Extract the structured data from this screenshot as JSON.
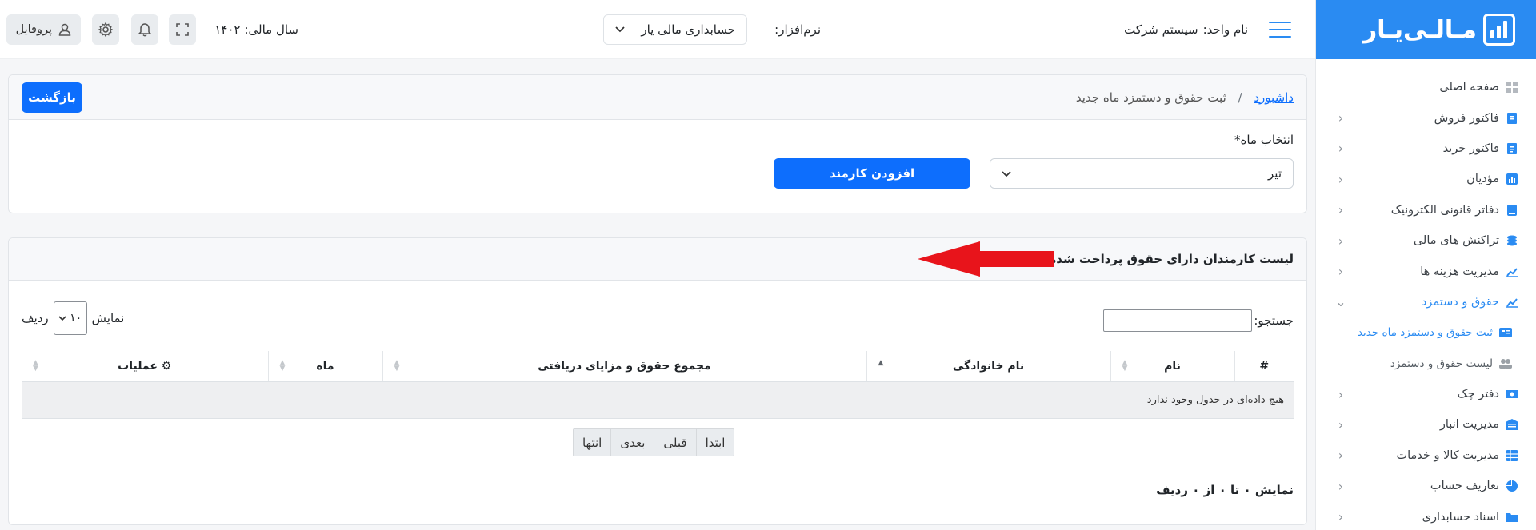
{
  "brand": {
    "logo_text": "مـالـی‌یـار"
  },
  "topbar": {
    "unit_label": "نام واحد:",
    "unit_value": "سیستم شرکت",
    "software_label": "نرم‌افزار:",
    "software_value": "حسابداری مالی یار",
    "fiscal_year_label": "سال مالی:",
    "fiscal_year_value": "۱۴۰۲",
    "profile_label": "پروفایل"
  },
  "sidebar": {
    "items": [
      {
        "label": "صفحه اصلی",
        "icon": "dashboard-icon"
      },
      {
        "label": "فاکتور فروش",
        "icon": "invoice-icon"
      },
      {
        "label": "فاکتور خرید",
        "icon": "purchase-invoice-icon"
      },
      {
        "label": "مؤدیان",
        "icon": "chart-icon"
      },
      {
        "label": "دفاتر قانونی الکترونیک",
        "icon": "book-icon"
      },
      {
        "label": "تراکنش های مالی",
        "icon": "coins-icon"
      },
      {
        "label": "مدیریت هزینه ها",
        "icon": "line-chart-icon"
      },
      {
        "label": "حقوق و دستمزد",
        "icon": "salary-icon"
      },
      {
        "label": "ثبت حقوق و دستمزد ماه جدید",
        "icon": "id-card-icon"
      },
      {
        "label": "لیست حقوق و دستمزد",
        "icon": "users-icon"
      },
      {
        "label": "دفتر چک",
        "icon": "money-icon"
      },
      {
        "label": "مدیریت انبار",
        "icon": "warehouse-icon"
      },
      {
        "label": "مدیریت کالا و خدمات",
        "icon": "table-icon"
      },
      {
        "label": "تعاریف حساب",
        "icon": "pie-icon"
      },
      {
        "label": "اسناد حسابداری",
        "icon": "folder-icon"
      }
    ]
  },
  "page": {
    "breadcrumb_home": "داشبورد",
    "breadcrumb_current": "ثبت حقوق و دستمزد ماه جدید",
    "back_button": "بازگشت",
    "month_label": "انتخاب ماه*",
    "month_value": "تیر",
    "add_employee_button": "افزودن کارمند"
  },
  "list": {
    "title": "لیست کارمندان دارای حقوق پرداخت شده در تیر ۱۴۰۲",
    "search_label": "جستجو:",
    "length_show": "نمایش",
    "length_value": "۱۰",
    "length_rows": "ردیف",
    "columns": [
      "#",
      "نام",
      "نام خانوادگی",
      "مجموع حقوق و مزایای دریافتی",
      "ماه",
      "عملیات"
    ],
    "empty_message": "هیچ داده‌ای در جدول وجود ندارد",
    "pager": [
      "ابتدا",
      "قبلی",
      "بعدی",
      "انتها"
    ],
    "info": "نمایش ۰ تا ۰ از ۰ ردیف"
  },
  "colors": {
    "brand": "#2a8bf2",
    "primary_button": "#0d6efd",
    "arrow": "#e8141b"
  }
}
